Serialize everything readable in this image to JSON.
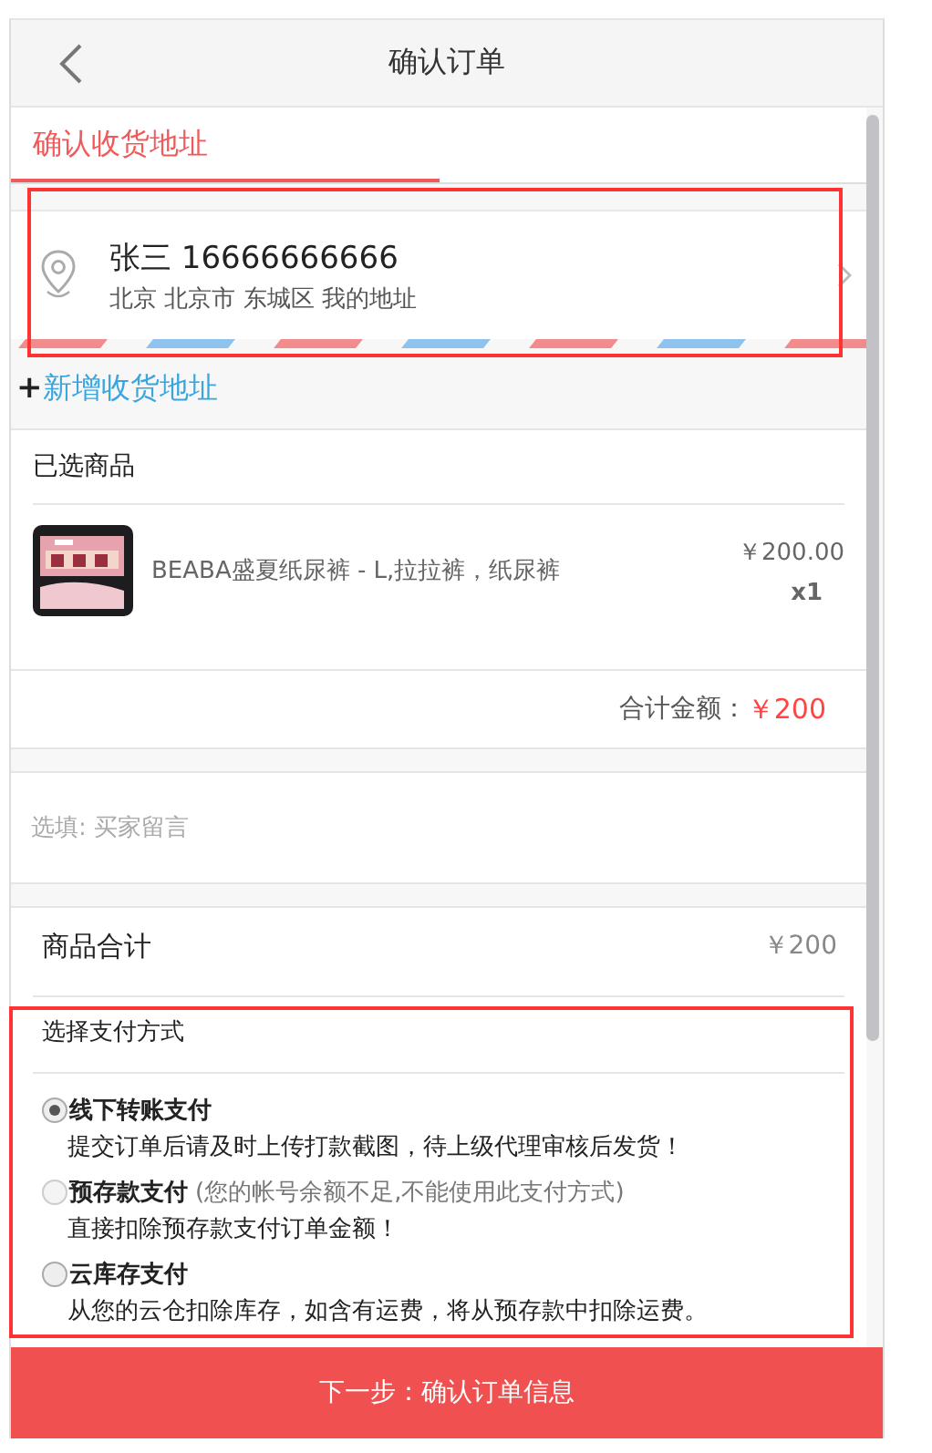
{
  "header": {
    "title": "确认订单"
  },
  "tabs": [
    {
      "label": "确认收货地址",
      "selected": true
    }
  ],
  "address": {
    "name_phone": "张三 16666666666",
    "detail": "北京 北京市 东城区 我的地址"
  },
  "add_address": {
    "plus": "+",
    "label": "新增收货地址"
  },
  "goods": {
    "title": "已选商品",
    "items": [
      {
        "kind": "picture",
        "name": "BEABA盛夏纸尿裤 - L,拉拉裤，纸尿裤",
        "price": "￥200.00",
        "qty": "x1"
      }
    ],
    "total_label": "合计金额：",
    "total_value": "￥200"
  },
  "message": {
    "placeholder": "选填: 买家留言"
  },
  "subtotal": {
    "label": "商品合计",
    "value": "￥200"
  },
  "payment": {
    "title": "选择支付方式",
    "options": [
      {
        "label": "线下转账支付",
        "description": "提交订单后请及时上传打款截图，待上级代理审核后发货！",
        "selected": true,
        "disabled": false
      },
      {
        "label": "预存款支付",
        "note": "(您的帐号余额不足,不能使用此支付方式)",
        "description": "直接扣除预存款支付订单金额！",
        "selected": false,
        "disabled": true
      },
      {
        "label": "云库存支付",
        "description": "从您的云仓扣除库存，如含有运费，将从预存款中扣除运费。",
        "selected": false,
        "disabled": false
      }
    ]
  },
  "submit": {
    "label": "下一步：确认订单信息"
  }
}
